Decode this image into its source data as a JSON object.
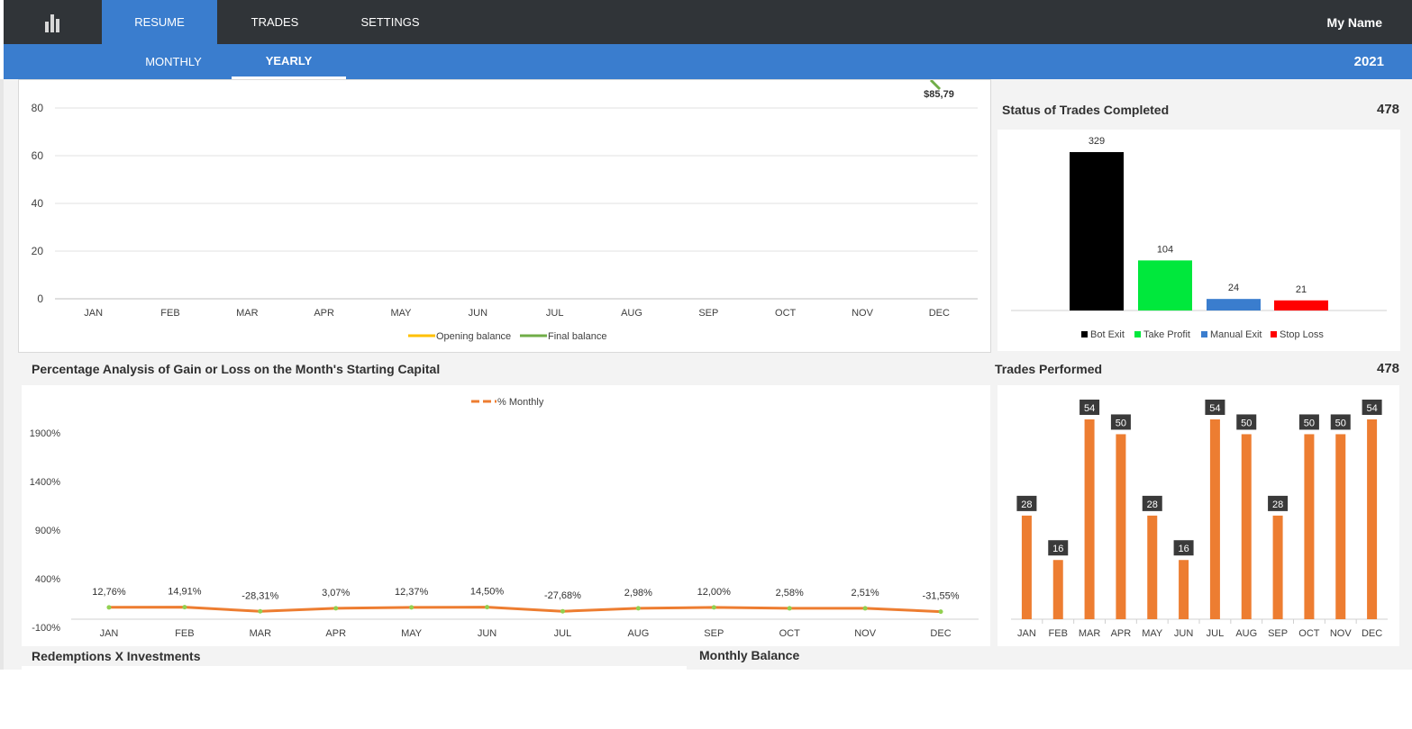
{
  "nav": {
    "tabs": [
      {
        "label": "RESUME",
        "active": true
      },
      {
        "label": "TRADES",
        "active": false
      },
      {
        "label": "SETTINGS",
        "active": false
      }
    ],
    "user_name": "My Name",
    "logo_icon": "bar-chart-icon"
  },
  "subnav": {
    "tabs": [
      {
        "label": "MONTHLY",
        "active": false
      },
      {
        "label": "YEARLY",
        "active": true
      }
    ],
    "year": "2021"
  },
  "colors": {
    "topbar": "#303438",
    "accent": "#3a7dce",
    "orange": "#ed7d31",
    "green_line": "#70ad47",
    "yellow_line": "#ffc000"
  },
  "balance_chart": {
    "chart_data": {
      "type": "line",
      "categories": [
        "JAN",
        "FEB",
        "MAR",
        "APR",
        "MAY",
        "JUN",
        "JUL",
        "AUG",
        "SEP",
        "OCT",
        "NOV",
        "DEC"
      ],
      "yticks": [
        "0",
        "20",
        "40",
        "60",
        "80"
      ],
      "ylim": [
        0,
        80
      ],
      "series": [
        {
          "name": "Opening balance",
          "color": "#ffc000",
          "values": []
        },
        {
          "name": "Final balance",
          "color": "#70ad47",
          "values": []
        }
      ],
      "annotation": "$85,79",
      "grid": true,
      "legend": "bottom"
    }
  },
  "status_chart": {
    "title": "Status of Trades Completed",
    "total": "478",
    "chart_data": {
      "type": "bar",
      "categories": [
        "Bot Exit",
        "Take Profit",
        "Manual Exit",
        "Stop Loss"
      ],
      "values": [
        329,
        104,
        24,
        21
      ],
      "colors": [
        "#000000",
        "#00e83c",
        "#3a7dce",
        "#ff0000"
      ],
      "value_labels": [
        "329",
        "104",
        "24",
        "21"
      ],
      "legend": "bottom"
    }
  },
  "percent_chart": {
    "title": "Percentage Analysis of Gain or Loss on the Month's Starting Capital",
    "chart_data": {
      "type": "line",
      "categories": [
        "JAN",
        "FEB",
        "MAR",
        "APR",
        "MAY",
        "JUN",
        "JUL",
        "AUG",
        "SEP",
        "OCT",
        "NOV",
        "DEC"
      ],
      "yticks": [
        "-100%",
        "400%",
        "900%",
        "1400%",
        "1900%"
      ],
      "ylim": [
        -100,
        1900
      ],
      "series": [
        {
          "name": "% Monthly",
          "color": "#ed7d31",
          "values": [
            12.76,
            14.91,
            -28.31,
            3.07,
            12.37,
            14.5,
            -27.68,
            2.98,
            12.0,
            2.58,
            2.51,
            -31.55
          ]
        }
      ],
      "value_labels": [
        "12,76%",
        "14,91%",
        "-28,31%",
        "3,07%",
        "12,37%",
        "14,50%",
        "-27,68%",
        "2,98%",
        "12,00%",
        "2,58%",
        "2,51%",
        "-31,55%"
      ],
      "legend": "top"
    }
  },
  "trades_chart": {
    "title": "Trades Performed",
    "total": "478",
    "chart_data": {
      "type": "bar",
      "categories": [
        "JAN",
        "FEB",
        "MAR",
        "APR",
        "MAY",
        "JUN",
        "JUL",
        "AUG",
        "SEP",
        "OCT",
        "NOV",
        "DEC"
      ],
      "values": [
        28,
        16,
        54,
        50,
        28,
        16,
        54,
        50,
        28,
        50,
        50,
        54
      ],
      "color": "#ed7d31",
      "value_labels": [
        "28",
        "16",
        "54",
        "50",
        "28",
        "16",
        "54",
        "50",
        "28",
        "50",
        "50",
        "54"
      ]
    }
  },
  "bottom": {
    "redemptions_title": "Redemptions X Investments",
    "monthly_balance_title": "Monthly Balance"
  }
}
